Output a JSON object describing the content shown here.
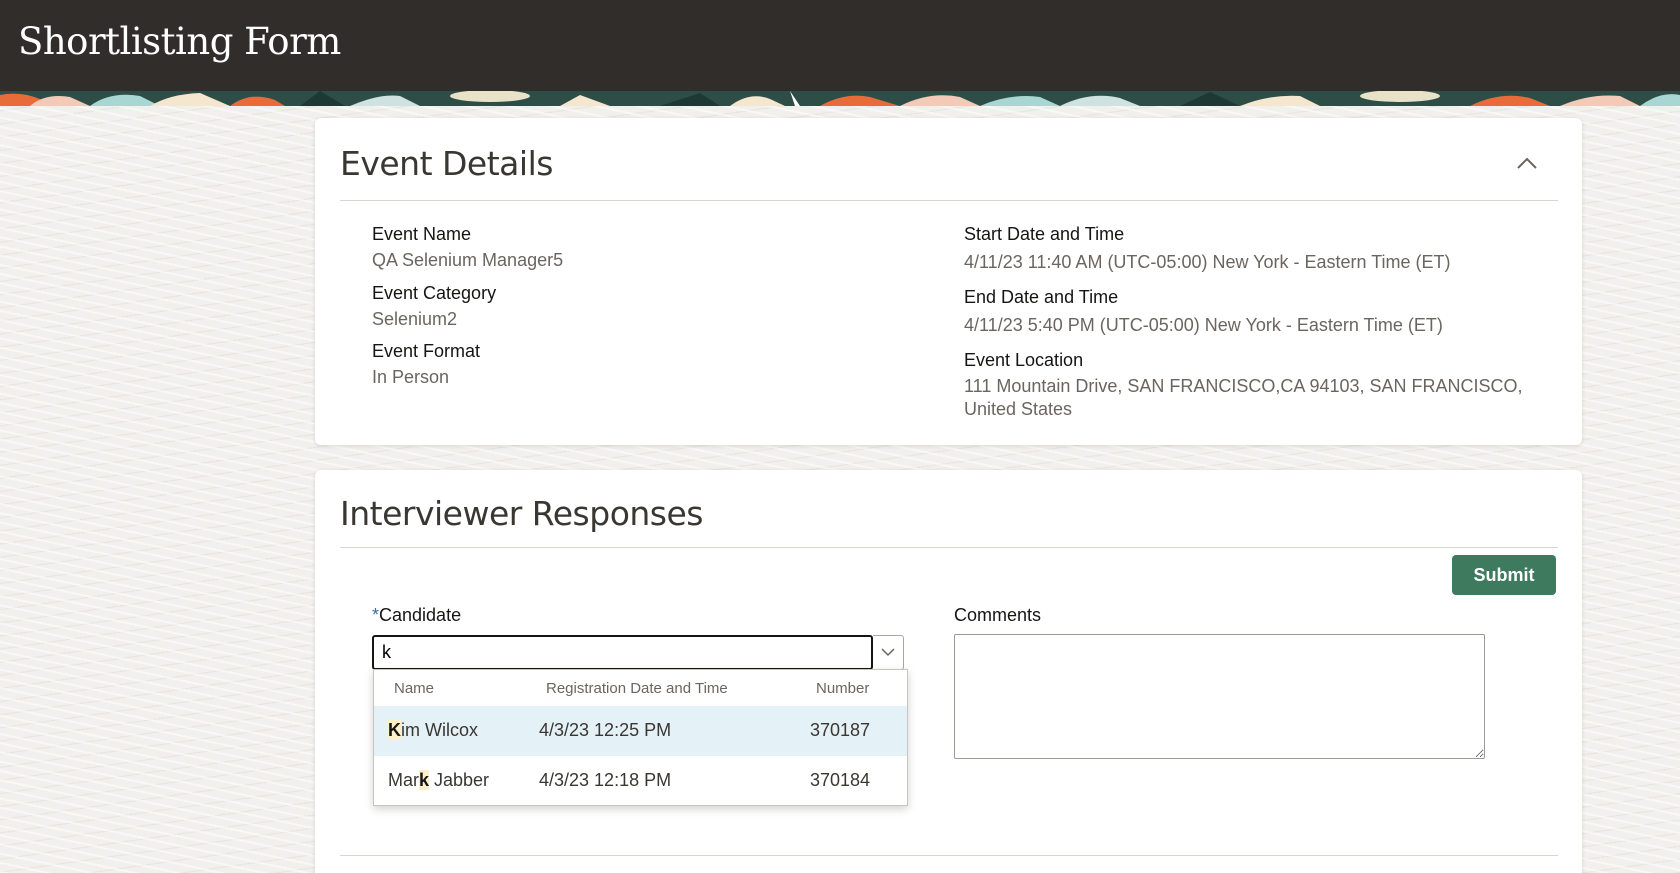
{
  "header": {
    "title": "Shortlisting Form"
  },
  "event_details": {
    "title": "Event Details",
    "fields": {
      "event_name": {
        "label": "Event Name",
        "value": "QA Selenium Manager5"
      },
      "event_category": {
        "label": "Event Category",
        "value": "Selenium2"
      },
      "event_format": {
        "label": "Event Format",
        "value": "In Person"
      },
      "start": {
        "label": "Start Date and Time",
        "value": "4/11/23 11:40 AM (UTC-05:00) New York - Eastern Time (ET)"
      },
      "end": {
        "label": "End Date and Time",
        "value": "4/11/23 5:40 PM (UTC-05:00) New York - Eastern Time (ET)"
      },
      "location": {
        "label": "Event Location",
        "value_line1": "111 Mountain Drive, SAN FRANCISCO,CA 94103, SAN FRANCISCO,",
        "value_line2": "United States"
      }
    },
    "collapse_icon": "chevron-up-icon"
  },
  "responses": {
    "title": "Interviewer Responses",
    "submit_label": "Submit",
    "candidate": {
      "required_mark": "*",
      "label": "Candidate",
      "value": "k",
      "dropdown_icon": "chevron-down-icon"
    },
    "comments": {
      "label": "Comments",
      "value": ""
    },
    "dropdown": {
      "columns": [
        "Name",
        "Registration Date and Time",
        "Number"
      ],
      "rows": [
        {
          "name_pre": "",
          "name_match": "K",
          "name_post": "im Wilcox",
          "date": "4/3/23 12:25 PM",
          "number": "370187"
        },
        {
          "name_pre": "Mar",
          "name_match": "k",
          "name_post": " Jabber",
          "date": "4/3/23 12:18 PM",
          "number": "370184"
        }
      ]
    }
  },
  "colors": {
    "header_bg": "#312d2a",
    "submit_bg": "#3d7a5e",
    "active_row": "#e4f1f7"
  }
}
